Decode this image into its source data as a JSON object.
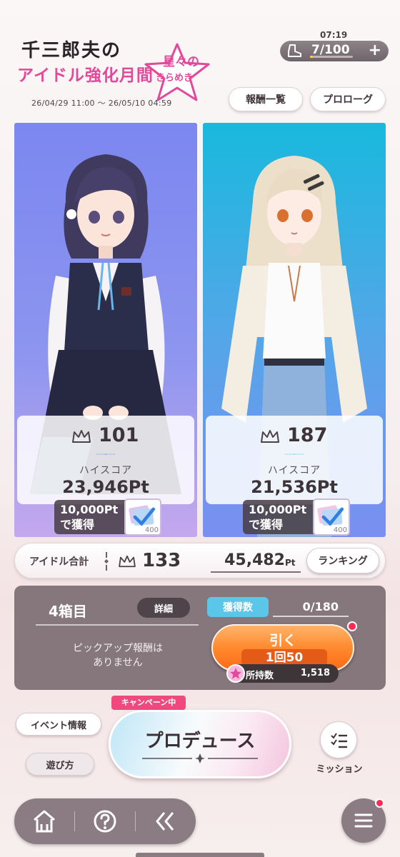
{
  "event": {
    "logo_line1": "千三郎夫の",
    "logo_line2": "アイドル強化月間",
    "logo_star_line1": "星々の",
    "logo_star_line2": "きらめき",
    "period": "26/04/29 11:00 ～ 26/05/10 04:59"
  },
  "stamina": {
    "timer": "07:19",
    "current": 7,
    "max": 100,
    "value_text": "7/100",
    "plus_label": "+",
    "icon": "boot-icon"
  },
  "header_buttons": {
    "rewards": "報酬一覧",
    "prologue": "プロローグ"
  },
  "idols": [
    {
      "rank": "101",
      "highscore_label": "ハイスコア",
      "highscore": "23,946Pt",
      "reward_text": "10,000Pt\nで獲得",
      "reward_qty": "400",
      "accent": "#3f8ee0"
    },
    {
      "rank": "187",
      "highscore_label": "ハイスコア",
      "highscore": "21,536Pt",
      "reward_text": "10,000Pt\nで獲得",
      "reward_qty": "400",
      "accent": "#36b9dd"
    }
  ],
  "totals": {
    "label": "アイドル合計",
    "rank": "133",
    "points": "45,482",
    "points_unit": "Pt",
    "ranking_button": "ランキング"
  },
  "box": {
    "label": "4箱目",
    "detail_button": "詳細",
    "gain_label": "獲得数",
    "gain_value": "0/180",
    "pickup_text": "ピックアップ報酬は\nありません",
    "draw_label": "引く",
    "draw_cost": "1回50",
    "held_label": "所持数",
    "held_value": "1,518"
  },
  "produce": {
    "campaign": "キャンペーン中",
    "label": "プロデュース",
    "event_info": "イベント情報",
    "how_to": "遊び方",
    "mission": "ミッション"
  },
  "nav": {
    "icons": [
      "home-icon",
      "help-icon",
      "back-icon",
      "menu-icon"
    ]
  },
  "colors": {
    "accent_pink": "#e2499a",
    "draw_orange": "#ff8a2e",
    "gain_blue": "#5cc6e8",
    "notify_red": "#ff2a53"
  }
}
